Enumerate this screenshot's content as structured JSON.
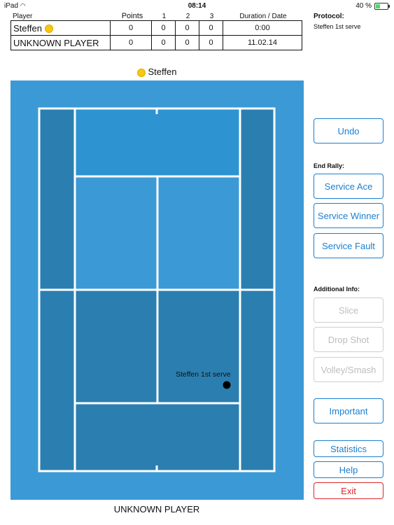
{
  "status_bar": {
    "device": "iPad",
    "time": "08:14",
    "battery": "40 %"
  },
  "score_table": {
    "headers": {
      "player": "Player",
      "points": "Points",
      "set1": "1",
      "set2": "2",
      "set3": "3",
      "duration": "Duration / Date"
    },
    "rows": [
      {
        "name": "Steffen",
        "points": "0",
        "set1": "0",
        "set2": "0",
        "set3": "0",
        "duration": "0:00"
      },
      {
        "name": "UNKNOWN PLAYER",
        "points": "0",
        "set1": "0",
        "set2": "0",
        "set3": "0",
        "duration": "11.02.14"
      }
    ]
  },
  "protocol": {
    "title": "Protocol:",
    "entry": "Steffen 1st serve"
  },
  "court": {
    "top_player": "Steffen",
    "bottom_player": "UNKNOWN PLAYER",
    "ball_label": "Steffen 1st serve"
  },
  "controls": {
    "undo": "Undo",
    "end_rally_title": "End Rally:",
    "service_ace": "Service Ace",
    "service_winner": "Service Winner",
    "service_fault": "Service Fault",
    "additional_info_title": "Additional Info:",
    "slice": "Slice",
    "drop_shot": "Drop Shot",
    "volley_smash": "Volley/Smash",
    "important": "Important",
    "statistics": "Statistics",
    "help": "Help",
    "exit": "Exit"
  },
  "colors": {
    "court_outer": "#3b9ad6",
    "alley": "#2a7fb0",
    "service_box": "#3b9ad6",
    "far_back": "#2d93d1",
    "near_half": "#2a7fb0",
    "accent": "#1a7fd0",
    "exit": "#d9262b",
    "ball": "#f6c90e"
  }
}
